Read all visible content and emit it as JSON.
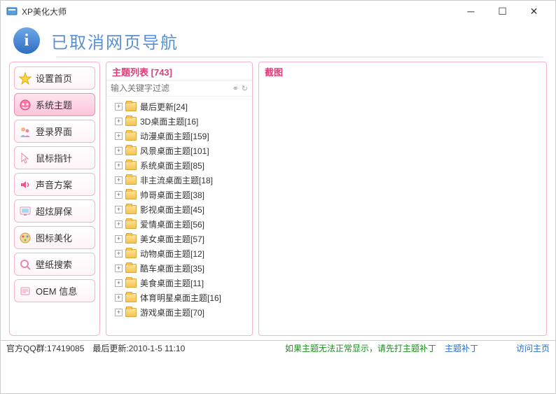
{
  "window": {
    "title": "XP美化大师"
  },
  "banner": {
    "text": "已取消网页导航"
  },
  "sidebar": {
    "items": [
      {
        "label": "设置首页",
        "name": "home"
      },
      {
        "label": "系统主题",
        "name": "system-theme",
        "active": true
      },
      {
        "label": "登录界面",
        "name": "login-screen"
      },
      {
        "label": "鼠标指针",
        "name": "cursor"
      },
      {
        "label": "声音方案",
        "name": "sound"
      },
      {
        "label": "超炫屏保",
        "name": "screensaver"
      },
      {
        "label": "图标美化",
        "name": "icon"
      },
      {
        "label": "壁纸搜索",
        "name": "wallpaper"
      },
      {
        "label": "OEM 信息",
        "name": "oem"
      }
    ]
  },
  "themes": {
    "title_prefix": "主题列表",
    "count": "[743]",
    "filter_placeholder": "输入关键字过滤",
    "items": [
      {
        "label": "最后更新",
        "count": 24
      },
      {
        "label": "3D桌面主题",
        "count": 16
      },
      {
        "label": "动漫桌面主题",
        "count": 159
      },
      {
        "label": "风景桌面主题",
        "count": 101
      },
      {
        "label": "系统桌面主题",
        "count": 85
      },
      {
        "label": "非主流桌面主题",
        "count": 18
      },
      {
        "label": "帅哥桌面主题",
        "count": 38
      },
      {
        "label": "影视桌面主题",
        "count": 45
      },
      {
        "label": "爱情桌面主题",
        "count": 56
      },
      {
        "label": "美女桌面主题",
        "count": 57
      },
      {
        "label": "动物桌面主题",
        "count": 12
      },
      {
        "label": "酷车桌面主题",
        "count": 35
      },
      {
        "label": "美食桌面主题",
        "count": 11
      },
      {
        "label": "体育明星桌面主题",
        "count": 16
      },
      {
        "label": "游戏桌面主题",
        "count": 70
      }
    ]
  },
  "screenshot_panel": {
    "title": "截图"
  },
  "status": {
    "qq": "官方QQ群:17419085",
    "update": "最后更新:2010-1-5 11:10",
    "warn": "如果主题无法正常显示，请先打主题补丁",
    "patch_link": "主题补丁",
    "home_link": "访问主页"
  }
}
